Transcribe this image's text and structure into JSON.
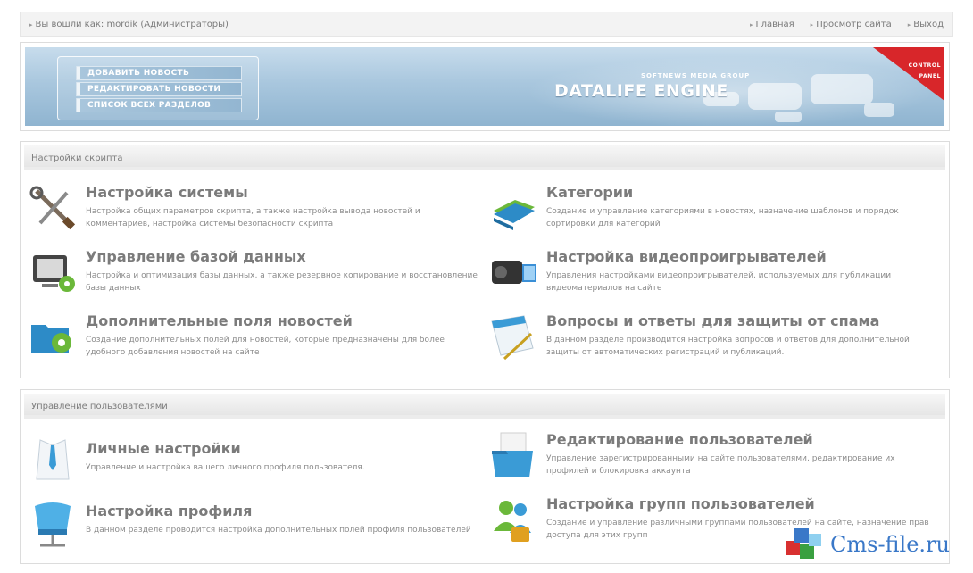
{
  "topbar": {
    "logged_in": "Вы вошли как: mordik (Администраторы)",
    "links": [
      "Главная",
      "Просмотр сайта",
      "Выход"
    ]
  },
  "banner": {
    "menu": [
      "Добавить новость",
      "Редактировать новости",
      "Список всех разделов"
    ],
    "logo_top": "SOFTNEWS MEDIA GROUP",
    "logo": "DATALIFE ENGINE",
    "corner_line1": "CONTROL",
    "corner_line2": "PANEL"
  },
  "section1": {
    "title": "Настройки скрипта",
    "items": [
      {
        "title": "Настройка системы",
        "desc": "Настройка общих параметров скрипта, а также настройка вывода новостей и комментариев, настройка системы безопасности скрипта",
        "icon": "tools-icon"
      },
      {
        "title": "Категории",
        "desc": "Создание и управление категориями в новостях, назначение шаблонов и порядок сортировки для категорий",
        "icon": "folders-icon"
      },
      {
        "title": "Управление базой данных",
        "desc": "Настройка и оптимизация базы данных, а также резервное копирование и восстановление базы данных",
        "icon": "database-monitor-icon"
      },
      {
        "title": "Настройка видеопроигрывателей",
        "desc": "Управления настройками видеопроигрывателей, используемых для публикации видеоматериалов на сайте",
        "icon": "video-camera-icon"
      },
      {
        "title": "Дополнительные поля новостей",
        "desc": "Создание дополнительных полей для новостей, которые предназначены для более удобного добавления новостей на сайте",
        "icon": "folder-gear-icon"
      },
      {
        "title": "Вопросы и ответы для защиты от спама",
        "desc": "В данном разделе производится настройка вопросов и ответов для дополнительной защиты от автоматических регистраций и публикаций.",
        "icon": "notepad-pen-icon"
      }
    ]
  },
  "section2": {
    "title": "Управление пользователями",
    "items": [
      {
        "title": "Личные настройки",
        "desc": "Управление и настройка вашего личного профиля пользователя.",
        "icon": "shirt-tie-icon"
      },
      {
        "title": "Редактирование пользователей",
        "desc": "Управление зарегистрированными на сайте пользователями, редактирование их профилей и блокировка аккаунта",
        "icon": "folder-users-icon"
      },
      {
        "title": "Настройка профиля",
        "desc": "В данном разделе проводится настройка дополнительных полей профиля пользователей",
        "icon": "chair-icon"
      },
      {
        "title": "Настройка групп пользователей",
        "desc": "Создание и управление различными группами пользователей на сайте, назначение прав доступа для этих групп",
        "icon": "users-lock-icon"
      }
    ]
  },
  "watermark": "Cms-file.ru",
  "colors": {
    "accent": "#3a78c8",
    "corner": "#d8262a"
  }
}
